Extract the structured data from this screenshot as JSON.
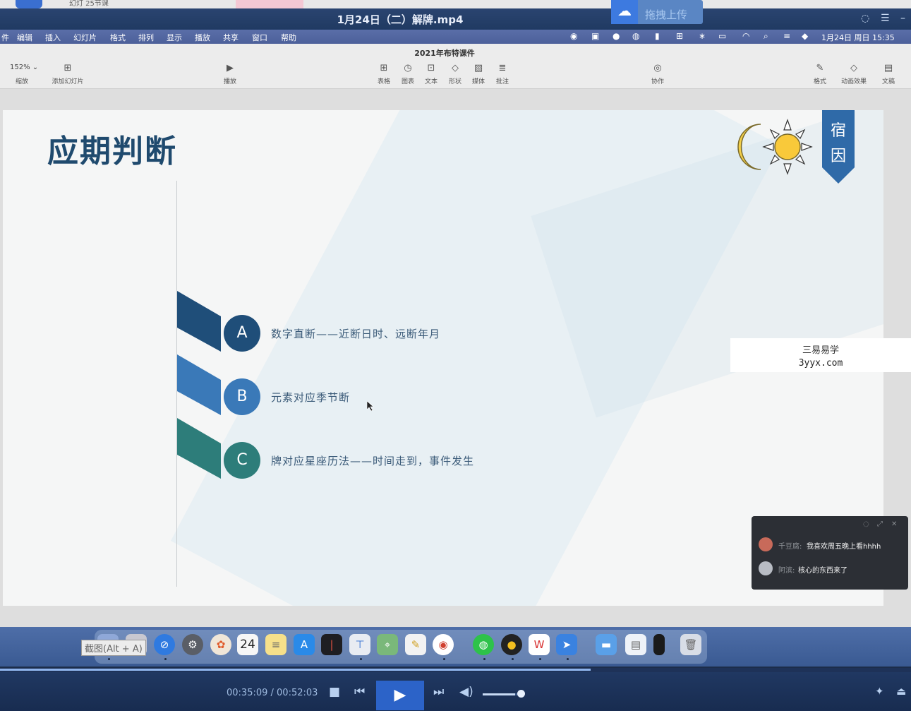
{
  "top_strip": {
    "tab_text": "幻灯 25节课"
  },
  "player": {
    "title": "1月24日（二）解牌.mp4",
    "upload_label": "拖拽上传",
    "upload_icon": "cloud-icon"
  },
  "menubar": {
    "items": [
      "件",
      "编辑",
      "插入",
      "幻灯片",
      "格式",
      "排列",
      "显示",
      "播放",
      "共享",
      "窗口",
      "帮助"
    ],
    "datetime": "1月24日 周日 15:35"
  },
  "keynote": {
    "doc_title": "2021年布特课件",
    "zoom_value": "152%",
    "zoom_label": "缩放",
    "add_slide_label": "添加幻灯片",
    "play_label": "播放",
    "insert_tools": [
      "表格",
      "图表",
      "文本",
      "形状",
      "媒体",
      "批注"
    ],
    "collab_label": "协作",
    "right_tools": [
      "格式",
      "动画效果",
      "文稿"
    ]
  },
  "slide": {
    "title": "应期判断",
    "bookmark_text": "宿\n因",
    "options": [
      {
        "letter": "A",
        "text": "数字直断——近断日时、远断年月",
        "color": "#1f4e79"
      },
      {
        "letter": "B",
        "text": "元素对应季节断",
        "color": "#3a79b8"
      },
      {
        "letter": "C",
        "text": "牌对应星座历法——时间走到，事件发生",
        "color": "#2d7d7a"
      }
    ]
  },
  "watermark": {
    "line1": "三易易学",
    "line2": "3yyx.com"
  },
  "chat": {
    "messages": [
      {
        "name": "千豆腐:",
        "text": "我喜欢周五晚上看hhhh"
      },
      {
        "name": "阿滨:",
        "text": "核心的东西来了"
      }
    ]
  },
  "dock": {
    "calendar_day": "24",
    "snip_hint": "截图(Alt + A)"
  },
  "playback": {
    "time": "00:35:09 / 00:52:03",
    "progress": 0.675,
    "volume": 0.85
  }
}
